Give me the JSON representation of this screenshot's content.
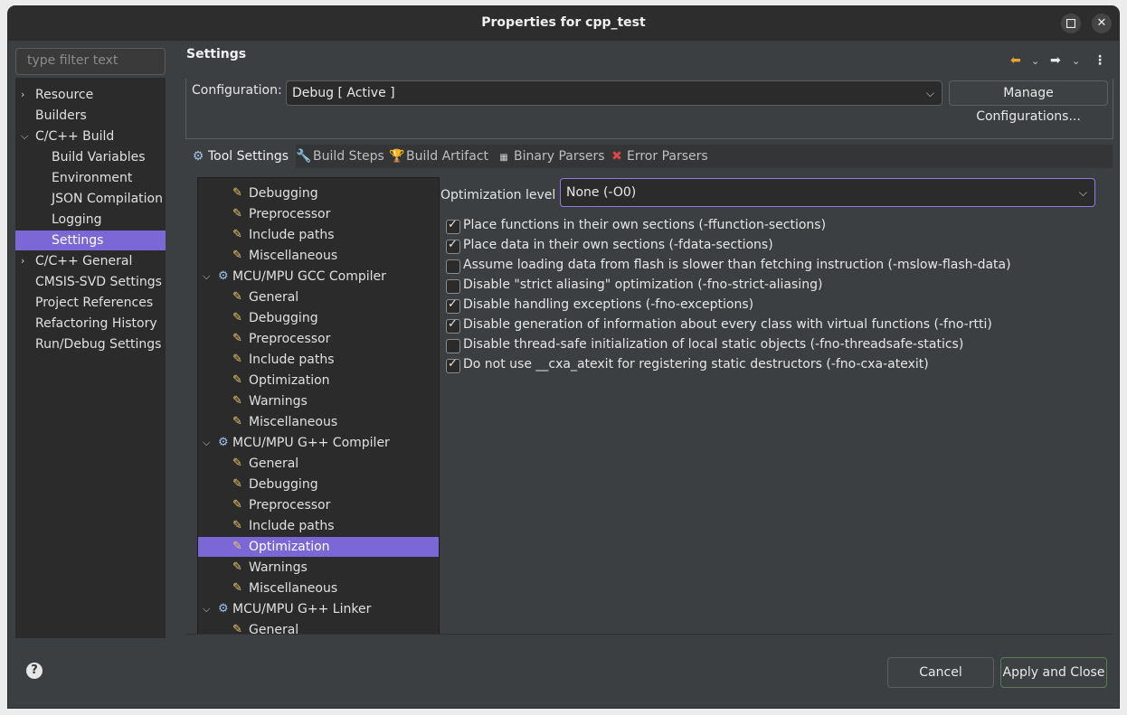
{
  "window": {
    "title": "Properties for cpp_test",
    "maximize_icon": "maximize-icon",
    "close_icon": "close-icon"
  },
  "filter": {
    "placeholder": "type filter text"
  },
  "nav": {
    "items": [
      {
        "label": "Resource",
        "expander": "collapsed"
      },
      {
        "label": "Builders"
      },
      {
        "label": "C/C++ Build",
        "expander": "expanded"
      },
      {
        "label": "Build Variables"
      },
      {
        "label": "Environment"
      },
      {
        "label": "JSON Compilation"
      },
      {
        "label": "Logging"
      },
      {
        "label": "Settings",
        "selected": true
      },
      {
        "label": "C/C++ General",
        "expander": "collapsed"
      },
      {
        "label": "CMSIS-SVD Settings"
      },
      {
        "label": "Project References"
      },
      {
        "label": "Refactoring History"
      },
      {
        "label": "Run/Debug Settings"
      }
    ]
  },
  "page": {
    "title": "Settings",
    "back_icon": "back-arrow-icon",
    "forward_icon": "forward-arrow-icon",
    "menu_icon": "kebab-menu-icon"
  },
  "config": {
    "label": "Configuration:",
    "value": "Debug  [ Active ]",
    "manage_button": "Manage Configurations..."
  },
  "tabs": [
    {
      "label": "Tool Settings",
      "active": true,
      "icon": "gear-icon"
    },
    {
      "label": "Build Steps",
      "icon": "wrench-icon"
    },
    {
      "label": "Build Artifact",
      "icon": "trophy-icon"
    },
    {
      "label": "Binary Parsers",
      "icon": "binary-icon"
    },
    {
      "label": "Error Parsers",
      "icon": "error-icon"
    }
  ],
  "tool_tree": [
    {
      "label": "Debugging",
      "level": 1
    },
    {
      "label": "Preprocessor",
      "level": 1
    },
    {
      "label": "Include paths",
      "level": 1
    },
    {
      "label": "Miscellaneous",
      "level": 1
    },
    {
      "label": "MCU/MPU GCC Compiler",
      "level": 0
    },
    {
      "label": "General",
      "level": 1
    },
    {
      "label": "Debugging",
      "level": 1
    },
    {
      "label": "Preprocessor",
      "level": 1
    },
    {
      "label": "Include paths",
      "level": 1
    },
    {
      "label": "Optimization",
      "level": 1
    },
    {
      "label": "Warnings",
      "level": 1
    },
    {
      "label": "Miscellaneous",
      "level": 1
    },
    {
      "label": "MCU/MPU G++ Compiler",
      "level": 0
    },
    {
      "label": "General",
      "level": 1
    },
    {
      "label": "Debugging",
      "level": 1
    },
    {
      "label": "Preprocessor",
      "level": 1
    },
    {
      "label": "Include paths",
      "level": 1
    },
    {
      "label": "Optimization",
      "level": 1,
      "selected": true
    },
    {
      "label": "Warnings",
      "level": 1
    },
    {
      "label": "Miscellaneous",
      "level": 1
    },
    {
      "label": "MCU/MPU G++ Linker",
      "level": 0
    },
    {
      "label": "General",
      "level": 1
    }
  ],
  "optimization": {
    "label": "Optimization level",
    "value": "None (-O0)",
    "options": [
      {
        "label": "Place functions in their own sections (-ffunction-sections)",
        "checked": true
      },
      {
        "label": "Place data in their own sections (-fdata-sections)",
        "checked": true
      },
      {
        "label": "Assume loading data from flash is slower than fetching instruction (-mslow-flash-data)",
        "checked": false
      },
      {
        "label": "Disable \"strict aliasing\" optimization (-fno-strict-aliasing)",
        "checked": false
      },
      {
        "label": "Disable handling exceptions (-fno-exceptions)",
        "checked": true
      },
      {
        "label": "Disable generation of information about every class with virtual functions (-fno-rtti)",
        "checked": true
      },
      {
        "label": "Disable thread-safe initialization of local static objects (-fno-threadsafe-statics)",
        "checked": false
      },
      {
        "label": "Do not use __cxa_atexit for registering static destructors (-fno-cxa-atexit)",
        "checked": true
      }
    ]
  },
  "footer": {
    "cancel": "Cancel",
    "apply_close": "Apply and Close",
    "help_icon": "help-icon"
  },
  "colors": {
    "selection": "#7b68d6",
    "background": "#3c3f41",
    "tree_bg": "#2b2b2b",
    "accent_icon": "#e8a32e"
  }
}
